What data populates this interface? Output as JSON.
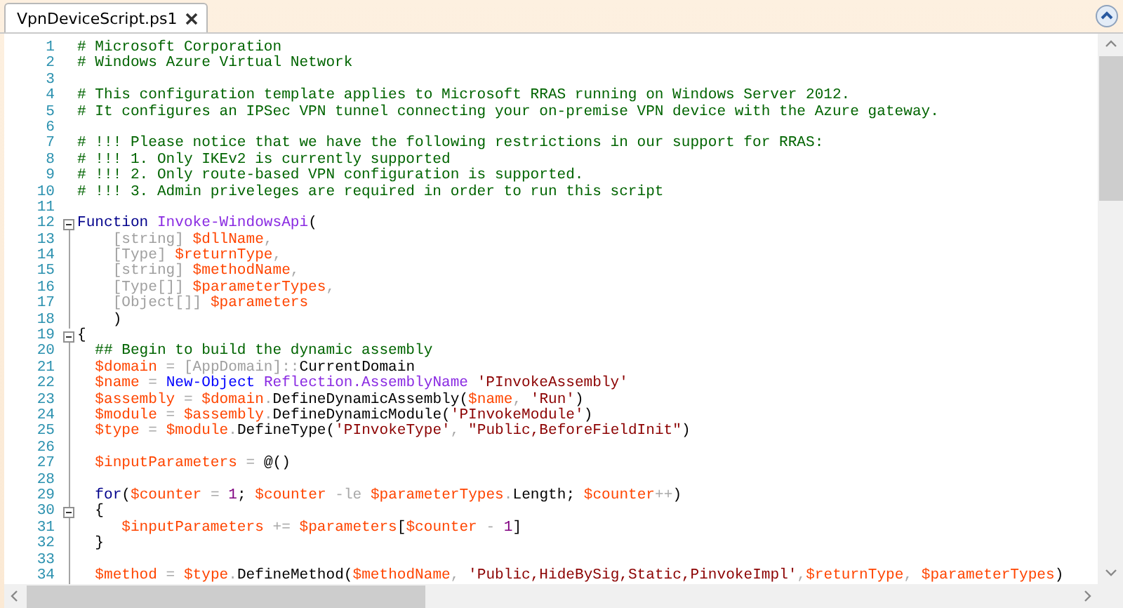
{
  "tabs": [
    {
      "label": "VpnDeviceScript.ps1",
      "selected": true
    }
  ],
  "editor": {
    "lines": [
      {
        "number": "1",
        "foldable": false,
        "in_block": false,
        "tokens": [
          {
            "kind": "comment",
            "text": "# Microsoft Corporation"
          }
        ]
      },
      {
        "number": "2",
        "foldable": false,
        "in_block": false,
        "tokens": [
          {
            "kind": "comment",
            "text": "# Windows Azure Virtual Network"
          }
        ]
      },
      {
        "number": "3",
        "foldable": false,
        "in_block": false
      },
      {
        "number": "4",
        "foldable": false,
        "in_block": false,
        "tokens": [
          {
            "kind": "comment",
            "text": "# This configuration template applies to Microsoft RRAS running on Windows Server 2012."
          }
        ]
      },
      {
        "number": "5",
        "foldable": false,
        "in_block": false,
        "tokens": [
          {
            "kind": "comment",
            "text": "# It configures an IPSec VPN tunnel connecting your on-premise VPN device with the Azure gateway."
          }
        ]
      },
      {
        "number": "6",
        "foldable": false,
        "in_block": false
      },
      {
        "number": "7",
        "foldable": false,
        "in_block": false,
        "tokens": [
          {
            "kind": "comment",
            "text": "# !!! Please notice that we have the following restrictions in our support for RRAS:"
          }
        ]
      },
      {
        "number": "8",
        "foldable": false,
        "in_block": false,
        "tokens": [
          {
            "kind": "comment",
            "text": "# !!! 1. Only IKEv2 is currently supported"
          }
        ]
      },
      {
        "number": "9",
        "foldable": false,
        "in_block": false,
        "tokens": [
          {
            "kind": "comment",
            "text": "# !!! 2. Only route-based VPN configuration is supported."
          }
        ]
      },
      {
        "number": "10",
        "foldable": false,
        "in_block": false,
        "tokens": [
          {
            "kind": "comment",
            "text": "# !!! 3. Admin priveleges are required in order to run this script"
          }
        ]
      },
      {
        "number": "11",
        "foldable": false,
        "in_block": false
      },
      {
        "number": "12",
        "foldable": true,
        "in_block": false,
        "tokens": [
          {
            "kind": "keyword",
            "text": "Function "
          },
          {
            "kind": "function",
            "text": "Invoke-WindowsApi"
          },
          {
            "kind": "plain",
            "text": "("
          }
        ]
      },
      {
        "number": "13",
        "foldable": false,
        "in_block": true,
        "tokens": [
          {
            "kind": "type",
            "text": "    [string] "
          },
          {
            "kind": "variable",
            "text": "$dllName"
          },
          {
            "kind": "operator",
            "text": ","
          }
        ]
      },
      {
        "number": "14",
        "foldable": false,
        "in_block": true,
        "tokens": [
          {
            "kind": "type",
            "text": "    [Type] "
          },
          {
            "kind": "variable",
            "text": "$returnType"
          },
          {
            "kind": "operator",
            "text": ","
          }
        ]
      },
      {
        "number": "15",
        "foldable": false,
        "in_block": true,
        "tokens": [
          {
            "kind": "type",
            "text": "    [string] "
          },
          {
            "kind": "variable",
            "text": "$methodName"
          },
          {
            "kind": "operator",
            "text": ","
          }
        ]
      },
      {
        "number": "16",
        "foldable": false,
        "in_block": true,
        "tokens": [
          {
            "kind": "type",
            "text": "    [Type[]] "
          },
          {
            "kind": "variable",
            "text": "$parameterTypes"
          },
          {
            "kind": "operator",
            "text": ","
          }
        ]
      },
      {
        "number": "17",
        "foldable": false,
        "in_block": true,
        "tokens": [
          {
            "kind": "type",
            "text": "    [Object[]] "
          },
          {
            "kind": "variable",
            "text": "$parameters"
          }
        ]
      },
      {
        "number": "18",
        "foldable": false,
        "in_block": true,
        "tokens": [
          {
            "kind": "plain",
            "text": "    )"
          }
        ]
      },
      {
        "number": "19",
        "foldable": true,
        "in_block": false,
        "tokens": [
          {
            "kind": "plain",
            "text": "{"
          }
        ]
      },
      {
        "number": "20",
        "foldable": false,
        "in_block": true,
        "tokens": [
          {
            "kind": "comment",
            "text": "  ## Begin to build the dynamic assembly"
          }
        ]
      },
      {
        "number": "21",
        "foldable": false,
        "in_block": true,
        "tokens": [
          {
            "kind": "variable",
            "text": "  $domain"
          },
          {
            "kind": "operator",
            "text": " = "
          },
          {
            "kind": "type",
            "text": "[AppDomain]"
          },
          {
            "kind": "operator",
            "text": "::"
          },
          {
            "kind": "member",
            "text": "CurrentDomain"
          }
        ]
      },
      {
        "number": "22",
        "foldable": false,
        "in_block": true,
        "tokens": [
          {
            "kind": "variable",
            "text": "  $name"
          },
          {
            "kind": "operator",
            "text": " = "
          },
          {
            "kind": "command",
            "text": "New-Object "
          },
          {
            "kind": "argument",
            "text": "Reflection.AssemblyName "
          },
          {
            "kind": "string",
            "text": "'PInvokeAssembly'"
          }
        ]
      },
      {
        "number": "23",
        "foldable": false,
        "in_block": true,
        "tokens": [
          {
            "kind": "variable",
            "text": "  $assembly"
          },
          {
            "kind": "operator",
            "text": " = "
          },
          {
            "kind": "variable",
            "text": "$domain"
          },
          {
            "kind": "operator",
            "text": "."
          },
          {
            "kind": "member",
            "text": "DefineDynamicAssembly("
          },
          {
            "kind": "variable",
            "text": "$name"
          },
          {
            "kind": "operator",
            "text": ", "
          },
          {
            "kind": "string",
            "text": "'Run'"
          },
          {
            "kind": "plain",
            "text": ")"
          }
        ]
      },
      {
        "number": "24",
        "foldable": false,
        "in_block": true,
        "tokens": [
          {
            "kind": "variable",
            "text": "  $module"
          },
          {
            "kind": "operator",
            "text": " = "
          },
          {
            "kind": "variable",
            "text": "$assembly"
          },
          {
            "kind": "operator",
            "text": "."
          },
          {
            "kind": "member",
            "text": "DefineDynamicModule("
          },
          {
            "kind": "string",
            "text": "'PInvokeModule'"
          },
          {
            "kind": "plain",
            "text": ")"
          }
        ]
      },
      {
        "number": "25",
        "foldable": false,
        "in_block": true,
        "tokens": [
          {
            "kind": "variable",
            "text": "  $type"
          },
          {
            "kind": "operator",
            "text": " = "
          },
          {
            "kind": "variable",
            "text": "$module"
          },
          {
            "kind": "operator",
            "text": "."
          },
          {
            "kind": "member",
            "text": "DefineType("
          },
          {
            "kind": "string",
            "text": "'PInvokeType'"
          },
          {
            "kind": "operator",
            "text": ", "
          },
          {
            "kind": "string",
            "text": "\"Public,BeforeFieldInit\""
          },
          {
            "kind": "plain",
            "text": ")"
          }
        ]
      },
      {
        "number": "26",
        "foldable": false,
        "in_block": true
      },
      {
        "number": "27",
        "foldable": false,
        "in_block": true,
        "tokens": [
          {
            "kind": "variable",
            "text": "  $inputParameters"
          },
          {
            "kind": "operator",
            "text": " = "
          },
          {
            "kind": "plain",
            "text": "@()"
          }
        ]
      },
      {
        "number": "28",
        "foldable": false,
        "in_block": true
      },
      {
        "number": "29",
        "foldable": false,
        "in_block": true,
        "tokens": [
          {
            "kind": "keyword",
            "text": "  for"
          },
          {
            "kind": "plain",
            "text": "("
          },
          {
            "kind": "variable",
            "text": "$counter"
          },
          {
            "kind": "operator",
            "text": " = "
          },
          {
            "kind": "number",
            "text": "1"
          },
          {
            "kind": "plain",
            "text": "; "
          },
          {
            "kind": "variable",
            "text": "$counter"
          },
          {
            "kind": "operator",
            "text": " -le "
          },
          {
            "kind": "variable",
            "text": "$parameterTypes"
          },
          {
            "kind": "operator",
            "text": "."
          },
          {
            "kind": "member",
            "text": "Length; "
          },
          {
            "kind": "variable",
            "text": "$counter"
          },
          {
            "kind": "operator",
            "text": "++"
          },
          {
            "kind": "plain",
            "text": ")"
          }
        ]
      },
      {
        "number": "30",
        "foldable": true,
        "in_block": true,
        "tokens": [
          {
            "kind": "plain",
            "text": "  {"
          }
        ]
      },
      {
        "number": "31",
        "foldable": false,
        "in_block": true,
        "tokens": [
          {
            "kind": "variable",
            "text": "     $inputParameters"
          },
          {
            "kind": "operator",
            "text": " += "
          },
          {
            "kind": "variable",
            "text": "$parameters"
          },
          {
            "kind": "plain",
            "text": "["
          },
          {
            "kind": "variable",
            "text": "$counter"
          },
          {
            "kind": "operator",
            "text": " - "
          },
          {
            "kind": "number",
            "text": "1"
          },
          {
            "kind": "plain",
            "text": "]"
          }
        ]
      },
      {
        "number": "32",
        "foldable": false,
        "in_block": true,
        "tokens": [
          {
            "kind": "plain",
            "text": "  }"
          }
        ]
      },
      {
        "number": "33",
        "foldable": false,
        "in_block": true
      },
      {
        "number": "34",
        "foldable": false,
        "in_block": true,
        "tokens": [
          {
            "kind": "variable",
            "text": "  $method"
          },
          {
            "kind": "operator",
            "text": " = "
          },
          {
            "kind": "variable",
            "text": "$type"
          },
          {
            "kind": "operator",
            "text": "."
          },
          {
            "kind": "member",
            "text": "DefineMethod("
          },
          {
            "kind": "variable",
            "text": "$methodName"
          },
          {
            "kind": "operator",
            "text": ", "
          },
          {
            "kind": "string",
            "text": "'Public,HideBySig,Static,PinvokeImpl'"
          },
          {
            "kind": "operator",
            "text": ","
          },
          {
            "kind": "variable",
            "text": "$returnType"
          },
          {
            "kind": "operator",
            "text": ", "
          },
          {
            "kind": "variable",
            "text": "$parameterTypes"
          },
          {
            "kind": "plain",
            "text": ")"
          }
        ]
      }
    ]
  }
}
